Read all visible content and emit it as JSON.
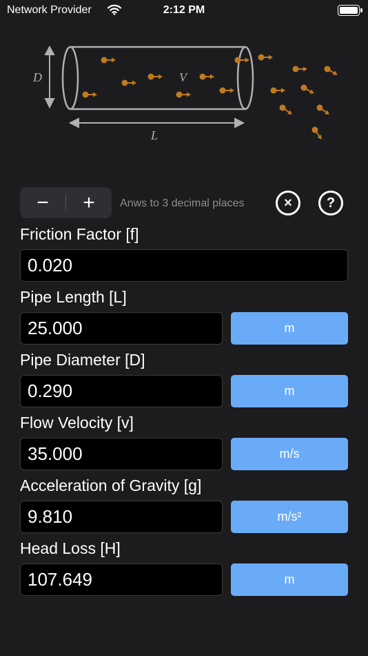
{
  "status_bar": {
    "carrier": "Network Provider",
    "time": "2:12 PM"
  },
  "diagram": {
    "label_d": "D",
    "label_v": "V",
    "label_l": "L"
  },
  "precision": {
    "minus": "−",
    "plus": "+",
    "hint": "Anws to 3 decimal places"
  },
  "icons": {
    "clear": "×",
    "help": "?"
  },
  "fields": [
    {
      "label": "Friction Factor [f]",
      "value": "0.020",
      "unit": ""
    },
    {
      "label": "Pipe Length [L]",
      "value": "25.000",
      "unit": "m"
    },
    {
      "label": "Pipe Diameter [D]",
      "value": "0.290",
      "unit": "m"
    },
    {
      "label": "Flow Velocity [v]",
      "value": "35.000",
      "unit": "m/s"
    },
    {
      "label": "Acceleration of Gravity [g]",
      "value": "9.810",
      "unit": "m/s²"
    },
    {
      "label": "Head Loss [H]",
      "value": "107.649",
      "unit": "m"
    }
  ],
  "colors": {
    "background": "#1c1c1e",
    "unit_button": "#6aabf8",
    "particle": "#c07a1e",
    "pipe": "#b0b0b0"
  }
}
